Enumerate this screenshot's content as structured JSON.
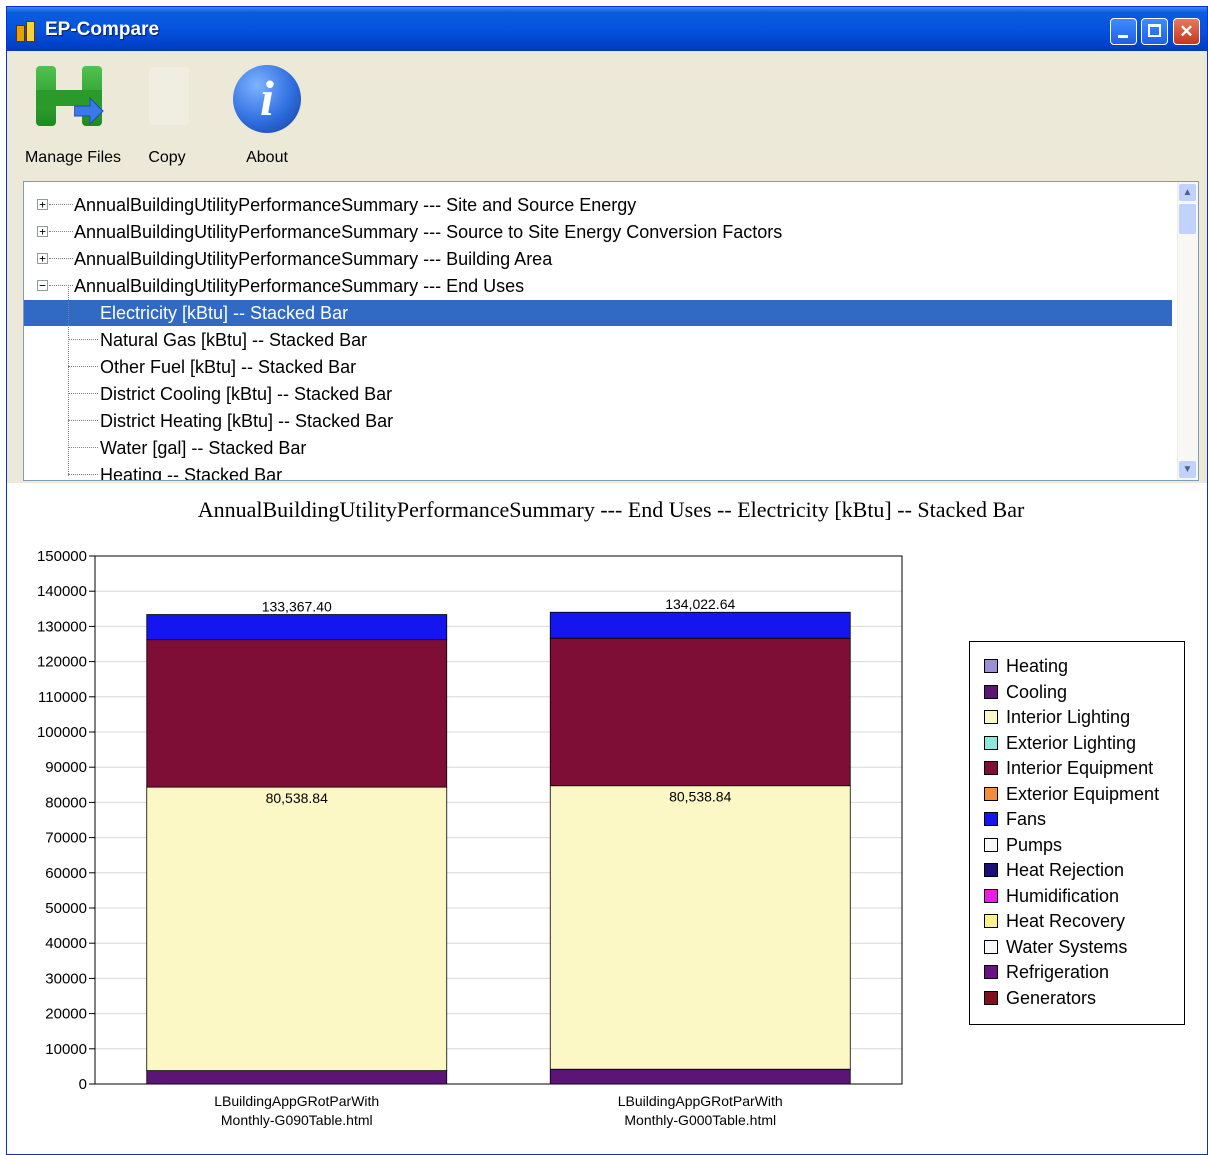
{
  "window": {
    "title": "EP-Compare"
  },
  "toolbar": {
    "manage_files": "Manage Files",
    "copy": "Copy",
    "about": "About"
  },
  "tree": {
    "items": [
      {
        "label": "AnnualBuildingUtilityPerformanceSummary --- Site and Source Energy",
        "level": 0,
        "expander": "+"
      },
      {
        "label": "AnnualBuildingUtilityPerformanceSummary --- Source to Site Energy Conversion Factors",
        "level": 0,
        "expander": "+"
      },
      {
        "label": "AnnualBuildingUtilityPerformanceSummary --- Building Area",
        "level": 0,
        "expander": "+"
      },
      {
        "label": "AnnualBuildingUtilityPerformanceSummary --- End Uses",
        "level": 0,
        "expander": "−"
      },
      {
        "label": "Electricity [kBtu] -- Stacked Bar",
        "level": 1,
        "selected": true
      },
      {
        "label": "Natural Gas [kBtu] -- Stacked Bar",
        "level": 1
      },
      {
        "label": "Other Fuel [kBtu] -- Stacked Bar",
        "level": 1
      },
      {
        "label": "District Cooling [kBtu] -- Stacked Bar",
        "level": 1
      },
      {
        "label": "District Heating [kBtu] -- Stacked Bar",
        "level": 1
      },
      {
        "label": "Water [gal] -- Stacked Bar",
        "level": 1
      },
      {
        "label": "Heating -- Stacked Bar",
        "level": 1
      }
    ]
  },
  "chart_data": {
    "type": "bar",
    "stacked": true,
    "title": "AnnualBuildingUtilityPerformanceSummary --- End Uses -- Electricity [kBtu] -- Stacked Bar",
    "categories": [
      [
        "LBuildingAppGRotParWith",
        "Monthly-G090Table.html"
      ],
      [
        "LBuildingAppGRotParWith",
        "Monthly-G000Table.html"
      ]
    ],
    "ylim": [
      0,
      150000
    ],
    "yticks": [
      0,
      10000,
      20000,
      30000,
      40000,
      50000,
      60000,
      70000,
      80000,
      90000,
      100000,
      110000,
      120000,
      130000,
      140000,
      150000
    ],
    "totals_labels": [
      "133,367.40",
      "134,022.64"
    ],
    "series": [
      {
        "name": "Heating",
        "color": "#9c8fd6",
        "values": [
          0,
          0
        ]
      },
      {
        "name": "Cooling",
        "color": "#5c1577",
        "values": [
          3800,
          4200
        ]
      },
      {
        "name": "Interior Lighting",
        "color": "#fbf8c6",
        "values": [
          80538.84,
          80538.84
        ],
        "value_labels": [
          "80,538.84",
          "80,538.84"
        ]
      },
      {
        "name": "Exterior Lighting",
        "color": "#8ee8da",
        "values": [
          0,
          0
        ]
      },
      {
        "name": "Interior Equipment",
        "color": "#7e0e36",
        "values": [
          41900,
          41900
        ]
      },
      {
        "name": "Exterior Equipment",
        "color": "#f28d3a",
        "values": [
          0,
          0
        ]
      },
      {
        "name": "Fans",
        "color": "#1515f0",
        "values": [
          7128.56,
          7383.8
        ]
      },
      {
        "name": "Pumps",
        "color": "#f8f8f8",
        "values": [
          0,
          0
        ]
      },
      {
        "name": "Heat Rejection",
        "color": "#1d0f78",
        "values": [
          0,
          0
        ]
      },
      {
        "name": "Humidification",
        "color": "#ec1ce6",
        "values": [
          0,
          0
        ]
      },
      {
        "name": "Heat Recovery",
        "color": "#fbf38a",
        "values": [
          0,
          0
        ]
      },
      {
        "name": "Water Systems",
        "color": "#f8f8f8",
        "values": [
          0,
          0
        ]
      },
      {
        "name": "Refrigeration",
        "color": "#6a1185",
        "values": [
          0,
          0
        ]
      },
      {
        "name": "Generators",
        "color": "#80101e",
        "values": [
          0,
          0
        ]
      }
    ],
    "legend": "right"
  }
}
